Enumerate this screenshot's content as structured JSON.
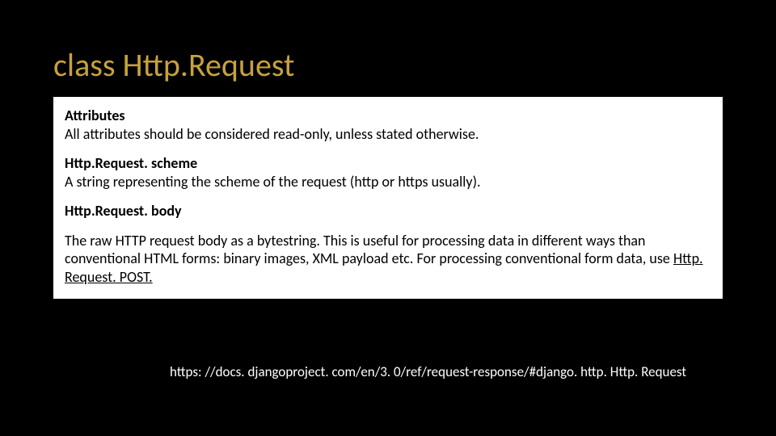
{
  "title": "class Http.Request",
  "box": {
    "attributes_heading": "Attributes",
    "attributes_text": "All attributes should be considered read-only, unless stated otherwise.",
    "scheme_heading": "Http.Request. scheme",
    "scheme_text": "A string representing the scheme of the request (http or https usually).",
    "body_heading": "Http.Request. body",
    "body_text_1": "The raw HTTP request body as a bytestring. This is useful for processing data in different ways than conventional HTML forms: binary images, XML payload etc. For processing conventional form data, use ",
    "body_link": "Http. Request. POST.",
    "body_text_2": ""
  },
  "footer_url": "https: //docs. djangoproject. com/en/3. 0/ref/request-response/#django. http. Http. Request"
}
